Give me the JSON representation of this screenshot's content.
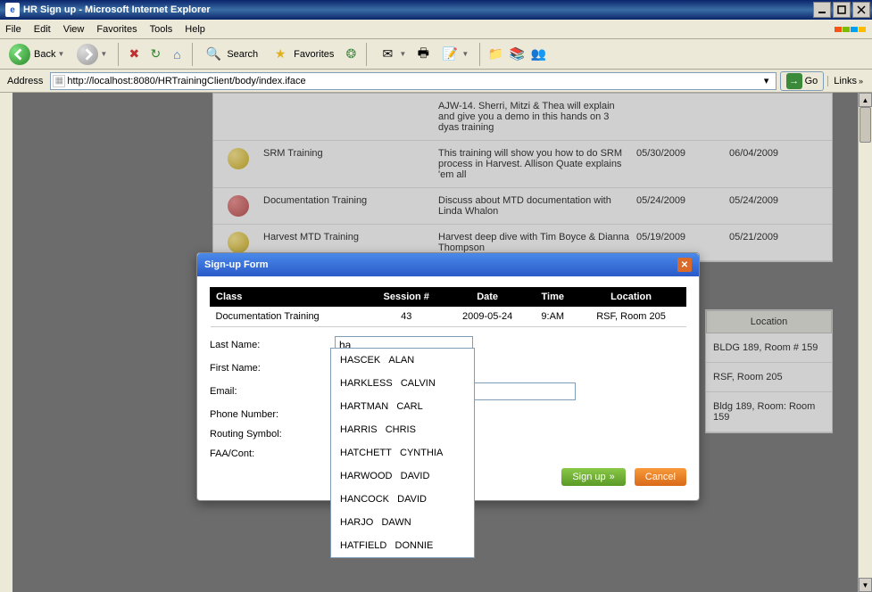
{
  "window": {
    "title": "HR Sign up - Microsoft Internet Explorer"
  },
  "menu": {
    "file": "File",
    "edit": "Edit",
    "view": "View",
    "favorites": "Favorites",
    "tools": "Tools",
    "help": "Help"
  },
  "toolbar": {
    "back": "Back",
    "search": "Search",
    "favorites": "Favorites"
  },
  "address": {
    "label": "Address",
    "url": "http://localhost:8080/HRTrainingClient/body/index.iface",
    "go": "Go",
    "links": "Links"
  },
  "bg_rows": [
    {
      "title": "",
      "desc": "AJW-14. Sherri, Mitzi & Thea will explain and give you a demo in this hands on 3 dyas training",
      "d1": "",
      "d2": "",
      "icon": ""
    },
    {
      "title": "SRM Training",
      "desc": "This training will show you how to do SRM process in Harvest. Allison Quate explains 'em all",
      "d1": "05/30/2009",
      "d2": "06/04/2009",
      "icon": "g"
    },
    {
      "title": "Documentation Training",
      "desc": "Discuss about MTD documentation with Linda Whalon",
      "d1": "05/24/2009",
      "d2": "05/24/2009",
      "icon": "r"
    },
    {
      "title": "Harvest MTD Training",
      "desc": "Harvest deep dive with Tim Boyce & Dianna Thompson",
      "d1": "05/19/2009",
      "d2": "05/21/2009",
      "icon": "g"
    }
  ],
  "loc_header": "Location",
  "loc_cells": [
    "BLDG 189, Room # 159",
    "RSF, Room 205",
    "Bldg 189, Room: Room 159"
  ],
  "modal": {
    "title": "Sign-up Form",
    "headers": {
      "class": "Class",
      "session": "Session #",
      "date": "Date",
      "time": "Time",
      "location": "Location"
    },
    "row": {
      "class": "Documentation Training",
      "session": "43",
      "date": "2009-05-24",
      "time": "9:AM",
      "location": "RSF, Room 205"
    },
    "labels": {
      "last": "Last Name:",
      "first": "First Name:",
      "email": "Email:",
      "phone": "Phone Number:",
      "routing": "Routing Symbol:",
      "faa": "FAA/Cont:"
    },
    "lastname_value": "ha",
    "signup": "Sign up",
    "cancel": "Cancel"
  },
  "autocomplete": [
    {
      "last": "HASCEK",
      "first": "ALAN"
    },
    {
      "last": "HARKLESS",
      "first": "CALVIN"
    },
    {
      "last": "HARTMAN",
      "first": "CARL"
    },
    {
      "last": "HARRIS",
      "first": "CHRIS"
    },
    {
      "last": "HATCHETT",
      "first": "CYNTHIA"
    },
    {
      "last": "HARWOOD",
      "first": "DAVID"
    },
    {
      "last": "HANCOCK",
      "first": "DAVID"
    },
    {
      "last": "HARJO",
      "first": "DAWN"
    },
    {
      "last": "HATFIELD",
      "first": "DONNIE"
    }
  ]
}
